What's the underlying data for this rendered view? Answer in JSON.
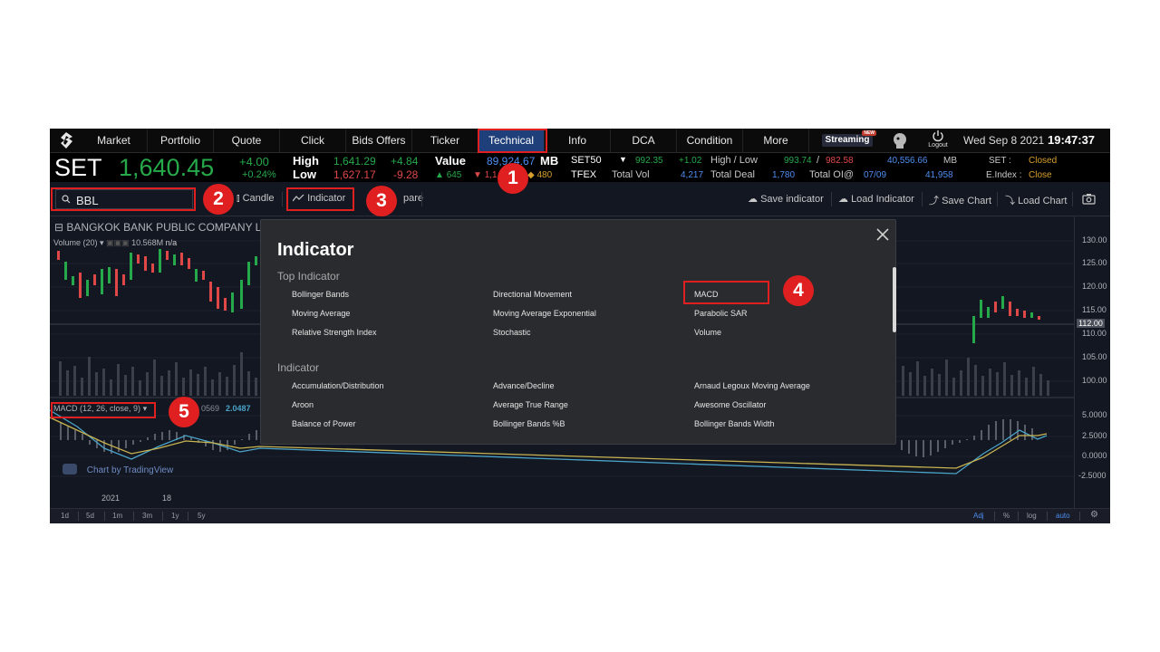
{
  "nav": {
    "items": [
      {
        "label": "Market"
      },
      {
        "label": "Portfolio"
      },
      {
        "label": "Quote"
      },
      {
        "label": "Click"
      },
      {
        "label": "Bids Offers"
      },
      {
        "label": "Ticker"
      },
      {
        "label": "Technical",
        "active": true
      },
      {
        "label": "Info"
      },
      {
        "label": "DCA"
      },
      {
        "label": "Condition"
      },
      {
        "label": "More"
      }
    ],
    "brand": "Streaming",
    "brand_badge": "NEW",
    "logout_label": "Logout",
    "date": "Wed Sep 8 2021",
    "time": "19:47:37"
  },
  "market": {
    "index_name": "SET",
    "index_value": "1,640.45",
    "change": "+4.00",
    "change_pct": "+0.24%",
    "high_label": "High",
    "high_value": "1,641.29",
    "high_change": "+4.84",
    "low_label": "Low",
    "low_value": "1,627.17",
    "low_change": "-9.28",
    "value_label": "Value",
    "value_amount": "89,924.67",
    "value_unit": "MB",
    "up_count": "645",
    "down_count": "1,1",
    "unch_count": "480",
    "set50_label": "SET50",
    "set50_value": "992.35",
    "set50_change": "+1.02",
    "high_low_label": "High / Low",
    "set50_high": "993.74",
    "set50_sep": "/",
    "set50_low": "982.58",
    "mb_value": "40,556.66",
    "mb_unit": "MB",
    "set_status_label": "SET :",
    "set_status": "Closed",
    "tfex_label": "TFEX",
    "total_vol_label": "Total Vol",
    "total_vol": "4,217",
    "total_deal_label": "Total Deal",
    "total_deal": "1,780",
    "total_oi_label": "Total OI@",
    "oi_date": "07/09",
    "oi_value": "41,958",
    "eindex_label": "E.Index :",
    "eindex_status": "Close"
  },
  "toolbar": {
    "search_value": "BBL",
    "candle_label": "Candle",
    "indicator_label": "Indicator",
    "compare_label": "pare",
    "save_indicator_label": "Save indicator",
    "load_indicator_label": "Load Indicator",
    "save_chart_label": "Save Chart",
    "load_chart_label": "Load Chart"
  },
  "chart": {
    "title": "BANGKOK BANK PUBLIC COMPANY LIM",
    "volume_label": "Volume (20)",
    "volume_value": "10.568M",
    "volume_na": "n/a",
    "macd_label": "MACD (12, 26, close, 9)",
    "macd_val1": "0569",
    "macd_val2": "2.0487",
    "tv_label": "Chart by TradingView",
    "price_ticks": [
      "130.00",
      "125.00",
      "120.00",
      "115.00",
      "110.00",
      "105.00",
      "100.00"
    ],
    "current_price": "112.00",
    "macd_ticks": [
      "5.0000",
      "2.5000",
      "0.0000",
      "-2.5000"
    ],
    "time_labels": [
      "2021",
      "18"
    ]
  },
  "bottom": {
    "timeframes": [
      "1d",
      "5d",
      "1m",
      "3m",
      "1y",
      "5y"
    ],
    "right_options": [
      "Adj",
      "%",
      "log",
      "auto"
    ]
  },
  "dialog": {
    "title": "Indicator",
    "top_section_label": "Top Indicator",
    "top_indicators": [
      "Bollinger Bands",
      "Directional Movement",
      "MACD",
      "Moving Average",
      "Moving Average Exponential",
      "Parabolic SAR",
      "Relative Strength Index",
      "Stochastic",
      "Volume"
    ],
    "section_label": "Indicator",
    "indicators": [
      "Accumulation/Distribution",
      "Advance/Decline",
      "Arnaud Legoux Moving Average",
      "Aroon",
      "Average True Range",
      "Awesome Oscillator",
      "Balance of Power",
      "Bollinger Bands %B",
      "Bollinger Bands Width"
    ]
  },
  "annotations": [
    "1",
    "2",
    "3",
    "4",
    "5"
  ],
  "colors": {
    "accent_red": "#e02020",
    "up_green": "#26a94a",
    "down_red": "#e04848",
    "link_blue": "#4d8df0",
    "active_tab": "#1f3f7a"
  }
}
